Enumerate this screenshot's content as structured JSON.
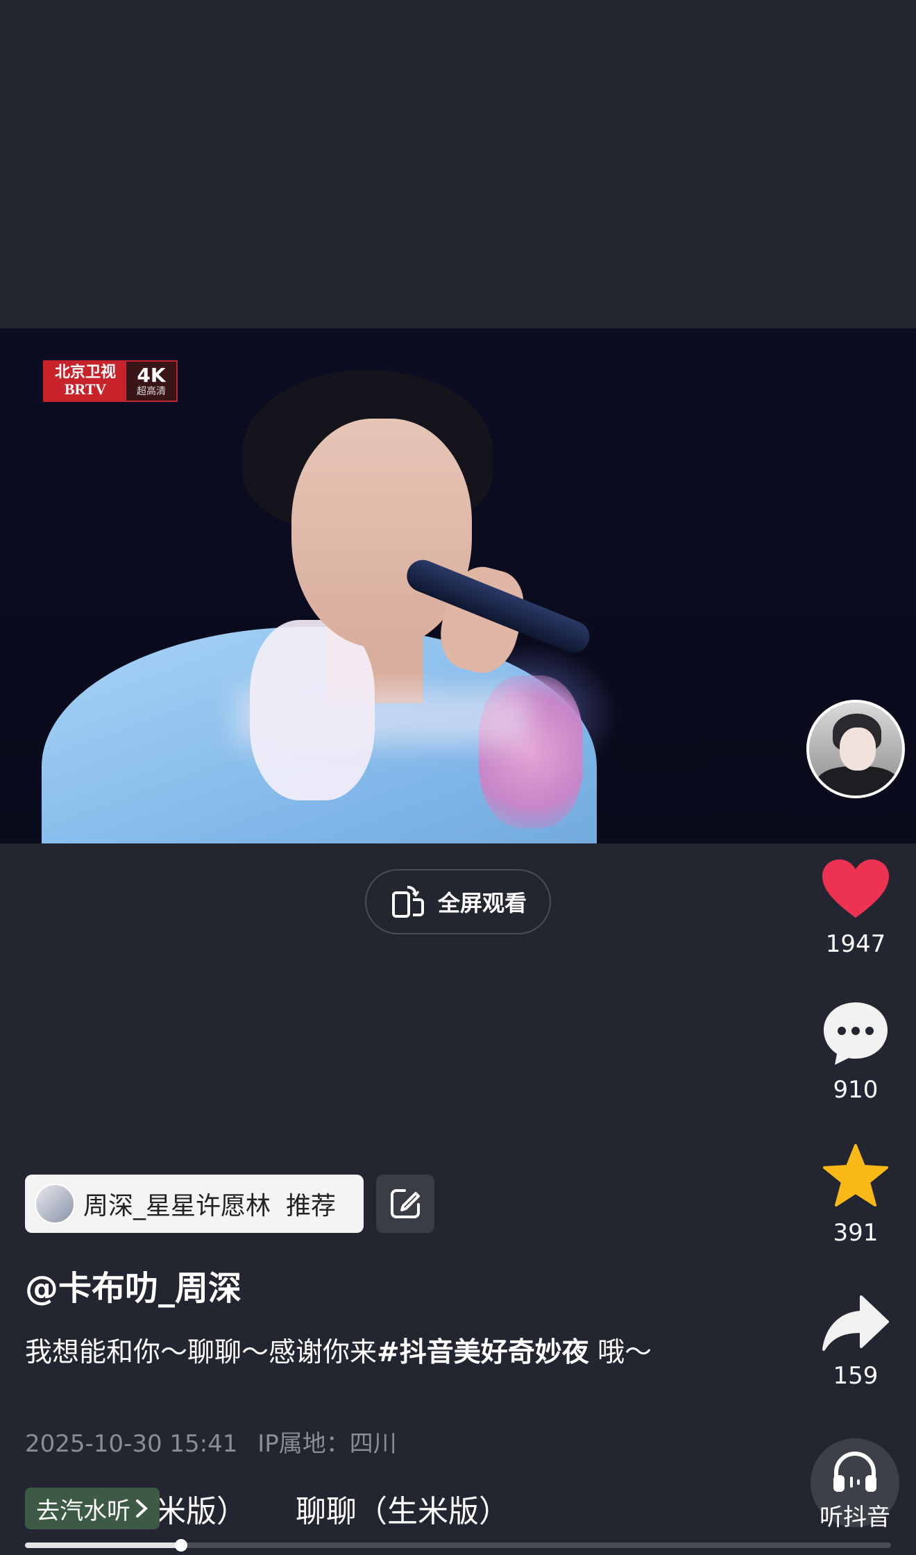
{
  "video": {
    "channel_logo_line1": "北京卫视",
    "channel_logo_line2": "BRTV",
    "quality_badge": "4K",
    "quality_sub": "超高清"
  },
  "fullscreen_button": {
    "label": "全屏观看",
    "icon": "rotate-phone-icon"
  },
  "rail": {
    "like": {
      "count": "1947",
      "icon": "heart-icon",
      "color": "#ee3352"
    },
    "comment": {
      "count": "910",
      "icon": "comment-bubble-icon"
    },
    "favorite": {
      "count": "391",
      "icon": "star-icon",
      "color": "#f9b916"
    },
    "share": {
      "count": "159",
      "icon": "share-arrow-icon"
    }
  },
  "recommend_chip": {
    "name": "周深_星星许愿林",
    "action": "推荐"
  },
  "author": "@卡布叻_周深",
  "description": {
    "text": "我想能和你～聊聊～感谢你来",
    "hashtag": "#抖音美好奇妙夜",
    "tail": "哦～"
  },
  "meta": {
    "date": "2025-10-30 15:41",
    "ip": "IP属地：四川"
  },
  "music": {
    "car_button": "去汽水听",
    "track_a": "米版）",
    "track_b": "聊聊（生米版）"
  },
  "listen": {
    "label": "听抖音",
    "icon": "headphones-icon"
  },
  "progress": {
    "fraction": 0.18
  }
}
